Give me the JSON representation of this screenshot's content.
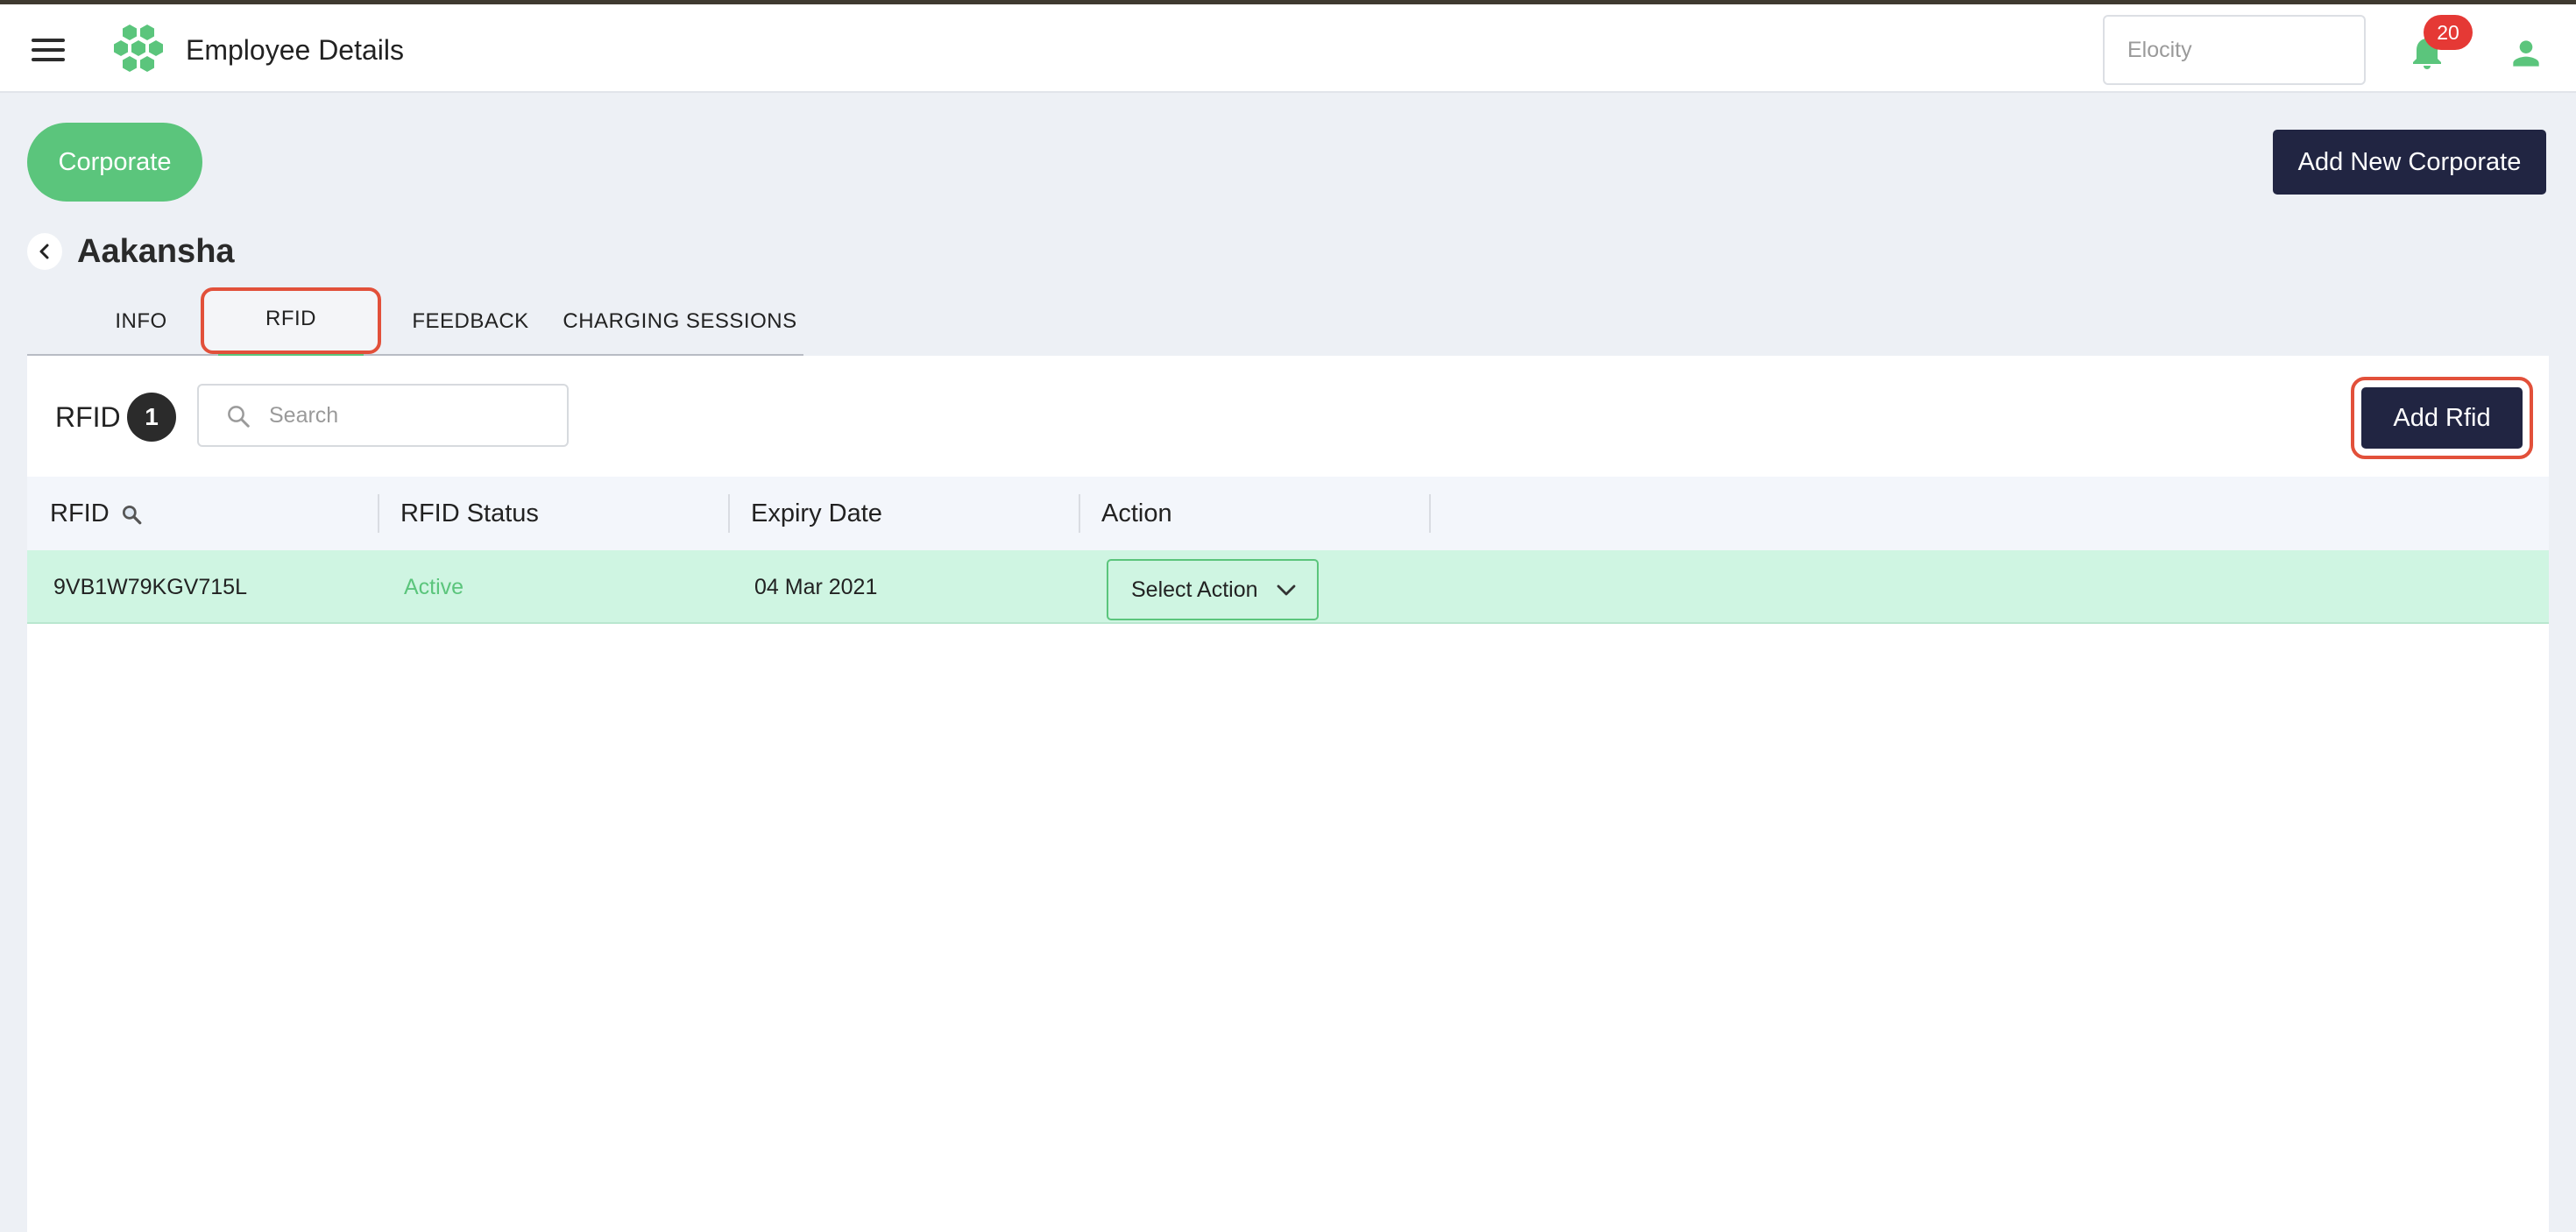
{
  "header": {
    "title": "Employee Details",
    "org_selector": "Elocity",
    "notification_count": "20",
    "icons": [
      "menu-icon",
      "logo-hexagon-icon",
      "bell-icon",
      "user-icon"
    ]
  },
  "actions": {
    "corporate_label": "Corporate",
    "add_new_corporate_label": "Add New Corporate"
  },
  "employee": {
    "name": "Aakansha"
  },
  "tabs": [
    {
      "label": "INFO",
      "active": false
    },
    {
      "label": "RFID",
      "active": true
    },
    {
      "label": "FEEDBACK",
      "active": false
    },
    {
      "label": "CHARGING SESSIONS",
      "active": false
    }
  ],
  "rfid_panel": {
    "title": "RFID",
    "count": "1",
    "search_placeholder": "Search",
    "add_button_label": "Add Rfid"
  },
  "table": {
    "columns": [
      "RFID",
      "RFID Status",
      "Expiry Date",
      "Action"
    ],
    "rows": [
      {
        "rfid": "9VB1W79KGV715L",
        "status": "Active",
        "expiry": "04 Mar 2021",
        "action": "Select Action"
      }
    ]
  },
  "colors": {
    "accent_green": "#5bc57c",
    "primary_dark": "#212542",
    "highlight_red": "#e2503a",
    "row_active": "#cff5e2"
  }
}
